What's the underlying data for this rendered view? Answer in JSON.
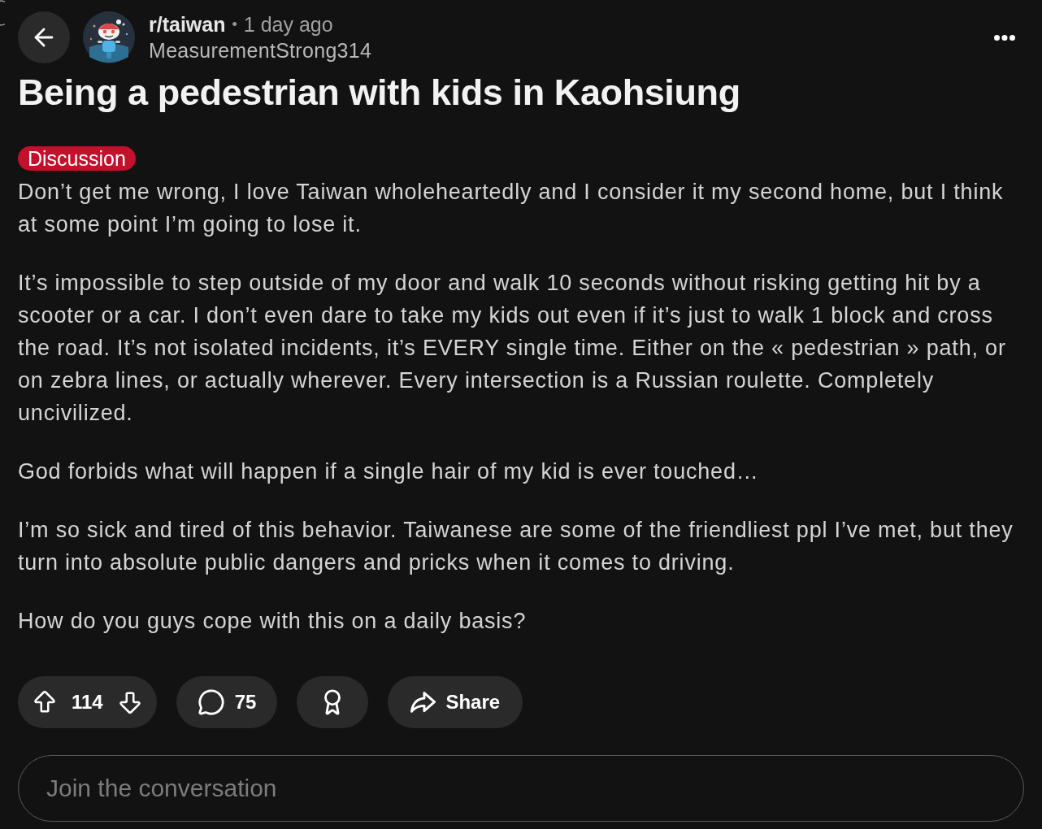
{
  "header": {
    "subreddit": "r/taiwan",
    "separator": "•",
    "time": "1 day ago",
    "author": "MeasurementStrong314"
  },
  "post": {
    "title": "Being a pedestrian with kids in Kaohsiung",
    "flair": "Discussion",
    "paragraphs": [
      [
        "Don’t get me wrong, I love Taiwan wholeheartedly and I consider it my second home, but I think",
        "at some point I’m going to lose it."
      ],
      [
        "It’s impossible to step outside of my door and walk 10 seconds without risking getting hit by a",
        "scooter or a car. I don’t even dare to take my kids out even if it’s just to walk 1 block and cross",
        "the road. It’s not isolated incidents, it’s EVERY single time. Either on the « pedestrian » path, or",
        "on zebra lines, or actually wherever. Every intersection is a Russian roulette. Completely",
        "uncivilized."
      ],
      [
        "God forbids what will happen if a single hair of my kid is ever touched…"
      ],
      [
        "I’m so sick and tired of this behavior. Taiwanese are some of the friendliest ppl I’ve met, but they",
        "turn into absolute public dangers and pricks when it comes to driving."
      ],
      [
        "How do you guys cope with this on a daily basis?"
      ]
    ]
  },
  "actions": [
    {
      "kind": "vote",
      "count": "114"
    },
    {
      "kind": "comments",
      "count": "75"
    },
    {
      "kind": "award"
    },
    {
      "kind": "share",
      "label": "Share"
    }
  ],
  "comment_box": {
    "placeholder": "Join the conversation"
  }
}
